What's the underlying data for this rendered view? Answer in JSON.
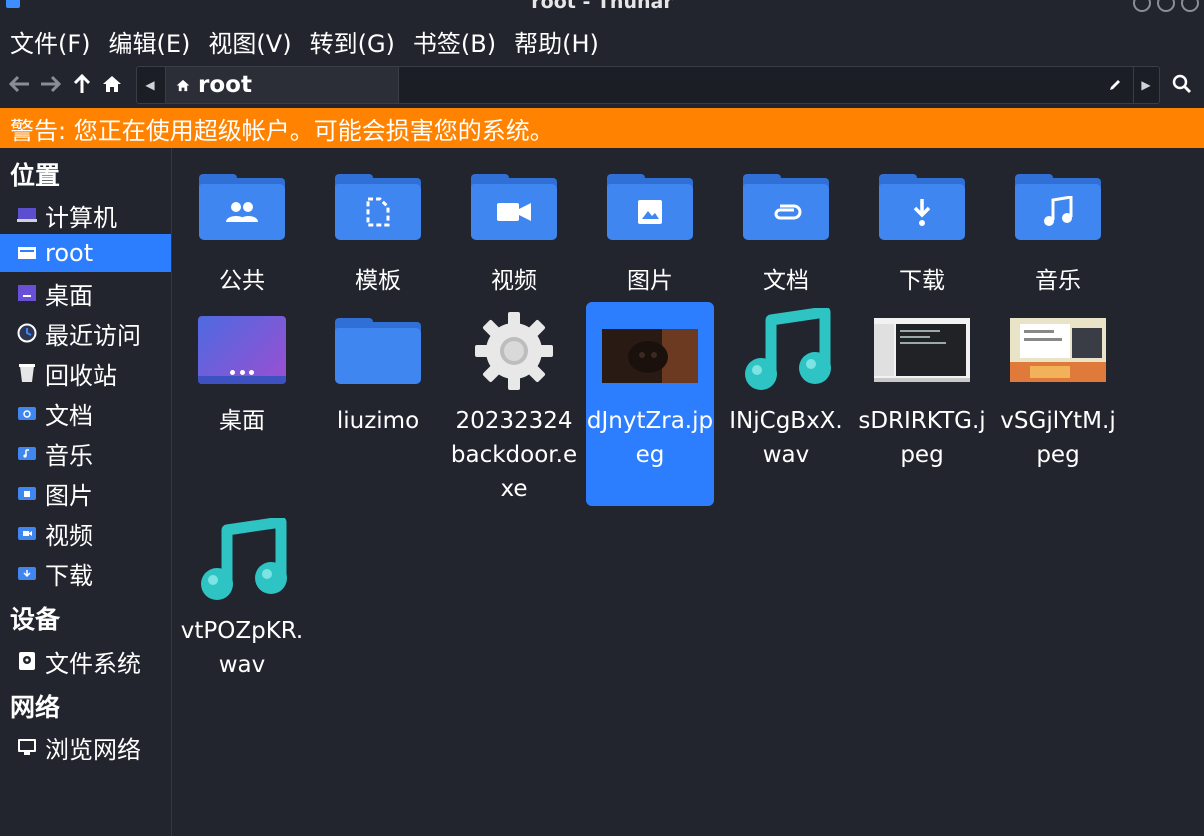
{
  "window": {
    "title": "root - Thunar"
  },
  "menu": [
    "文件(F)",
    "编辑(E)",
    "视图(V)",
    "转到(G)",
    "书签(B)",
    "帮助(H)"
  ],
  "path": {
    "current": "root"
  },
  "warning": "警告: 您正在使用超级帐户。可能会损害您的系统。",
  "sidebar": {
    "places_header": "位置",
    "places": [
      {
        "label": "计算机",
        "icon": "computer-icon"
      },
      {
        "label": "root",
        "icon": "home-folder-icon"
      },
      {
        "label": "桌面",
        "icon": "desktop-icon"
      },
      {
        "label": "最近访问",
        "icon": "recent-icon"
      },
      {
        "label": "回收站",
        "icon": "trash-icon"
      },
      {
        "label": "文档",
        "icon": "documents-icon"
      },
      {
        "label": "音乐",
        "icon": "music-icon"
      },
      {
        "label": "图片",
        "icon": "pictures-icon"
      },
      {
        "label": "视频",
        "icon": "videos-icon"
      },
      {
        "label": "下载",
        "icon": "downloads-icon"
      }
    ],
    "devices_header": "设备",
    "devices": [
      {
        "label": "文件系统",
        "icon": "drive-icon"
      }
    ],
    "network_header": "网络",
    "network": [
      {
        "label": "浏览网络",
        "icon": "network-icon"
      }
    ]
  },
  "files": [
    {
      "name": "公共",
      "icon": "folder-public-icon"
    },
    {
      "name": "模板",
      "icon": "folder-templates-icon"
    },
    {
      "name": "视频",
      "icon": "folder-videos-icon"
    },
    {
      "name": "图片",
      "icon": "folder-pictures-icon"
    },
    {
      "name": "文档",
      "icon": "folder-documents-icon"
    },
    {
      "name": "下载",
      "icon": "folder-downloads-icon"
    },
    {
      "name": "音乐",
      "icon": "folder-music-icon"
    },
    {
      "name": "桌面",
      "icon": "folder-desktop-icon"
    },
    {
      "name": "liuzimo",
      "icon": "folder-icon"
    },
    {
      "name": "20232324backdoor.exe",
      "icon": "gear-icon"
    },
    {
      "name": "dJnytZra.jpeg",
      "icon": "image-thumbnail-icon",
      "selected": true
    },
    {
      "name": "INjCgBxX.wav",
      "icon": "music-note-icon"
    },
    {
      "name": "sDRIRKTG.jpeg",
      "icon": "image-thumbnail-icon"
    },
    {
      "name": "vSGjlYtM.jpeg",
      "icon": "image-thumbnail-icon"
    },
    {
      "name": "vtPOZpKR.wav",
      "icon": "music-note-icon"
    }
  ],
  "colors": {
    "background": "#23252e",
    "accent": "#2d7eff",
    "warning": "#ff8300",
    "folder": "#3f86f0",
    "music": "#2ec4c4"
  }
}
